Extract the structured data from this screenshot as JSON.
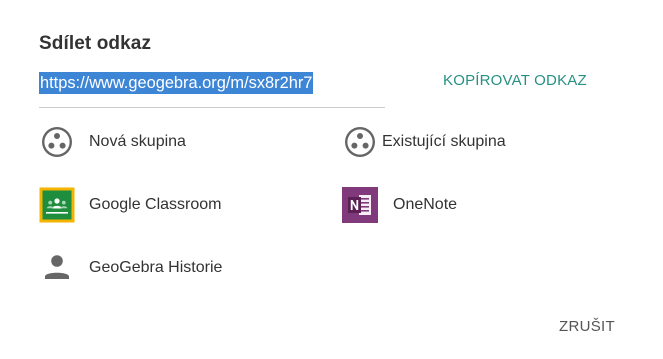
{
  "dialog": {
    "title": "Sdílet odkaz",
    "share_link": "https://www.geogebra.org/m/sx8r2hr7",
    "copy_label": "KOPÍROVAT ODKAZ",
    "cancel_label": "ZRUŠIT"
  },
  "options": [
    {
      "label": "Nová skupina",
      "icon": "group-icon"
    },
    {
      "label": "Existující skupina",
      "icon": "group-icon"
    },
    {
      "label": "Google Classroom",
      "icon": "google-classroom-icon"
    },
    {
      "label": "OneNote",
      "icon": "onenote-icon"
    },
    {
      "label": "GeoGebra Historie",
      "icon": "person-icon"
    }
  ],
  "colors": {
    "accent": "#279083",
    "selection": "#3d86d6",
    "classroom_border": "#f4b400",
    "classroom_green": "#1e8e3e",
    "onenote_purple": "#80397b"
  }
}
